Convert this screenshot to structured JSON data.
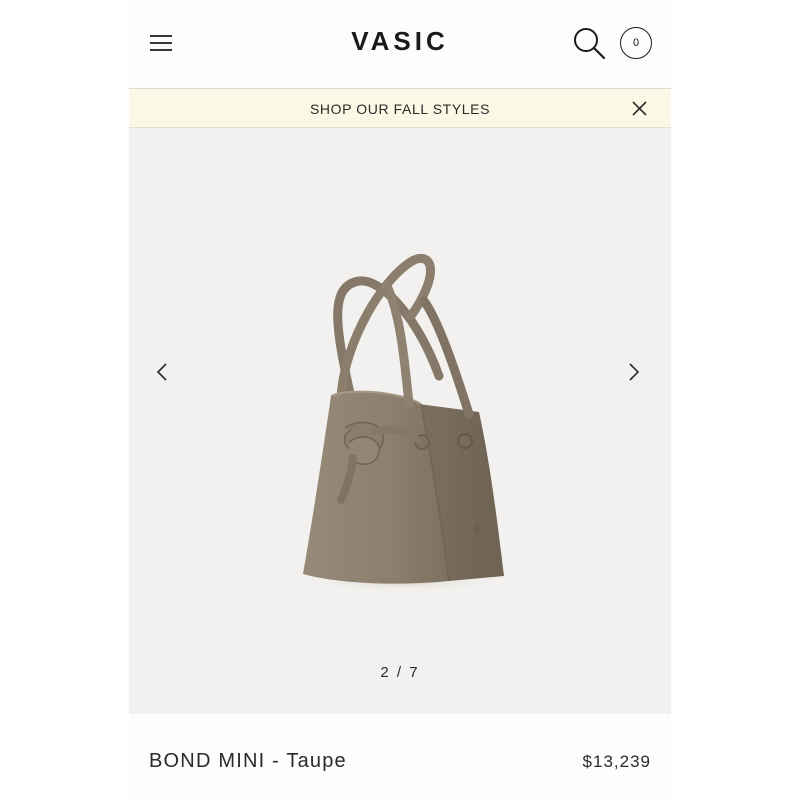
{
  "header": {
    "logo": "VASIC",
    "cart_count": "0",
    "icons": [
      "hamburger-menu-icon",
      "search-icon",
      "cart-icon"
    ]
  },
  "promo": {
    "text": "SHOP OUR FALL STYLES",
    "close_icon": "close-icon"
  },
  "gallery": {
    "counter": "2 / 7",
    "current": 2,
    "total": 7,
    "icons": [
      "chevron-left-icon",
      "chevron-right-icon"
    ],
    "image": "taupe-bucket-bag"
  },
  "product": {
    "name": "BOND MINI - Taupe",
    "price": "$13,239"
  },
  "colors": {
    "background": "#fdfdfb",
    "promo_background": "#fbf9e6",
    "gallery_background": "#f3f1ef",
    "bag_taupe": "#8c7f6e",
    "text": "#2a2a2a"
  }
}
